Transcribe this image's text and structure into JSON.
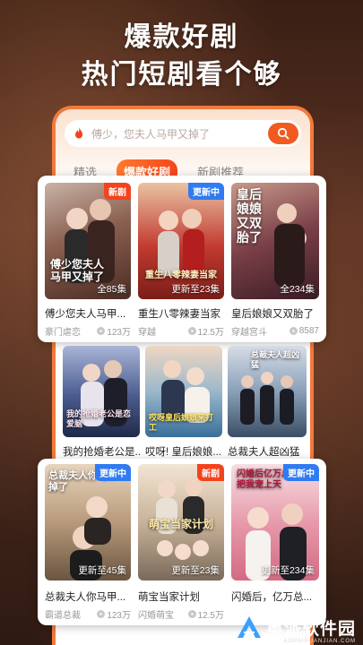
{
  "headline": {
    "line1": "爆款好剧",
    "line2": "热门短剧看个够"
  },
  "search": {
    "placeholder": "傅少，您夫人马甲又掉了"
  },
  "tabs": [
    {
      "label": "精选",
      "active": false
    },
    {
      "label": "爆款好剧",
      "active": true
    },
    {
      "label": "新剧推荐",
      "active": false
    }
  ],
  "rows": [
    {
      "items": [
        {
          "title": "傅少您夫人马甲...",
          "tag": "豪门虐恋",
          "views": "123万",
          "badge": "新剧",
          "badge_type": "new",
          "episodes": "全85集",
          "poster_text": "傅少您夫人马甲又掉了",
          "colors": [
            "#6b4a3a",
            "#c9b3a6"
          ]
        },
        {
          "title": "重生八零辣妻当家",
          "tag": "穿越",
          "views": "12.5万",
          "badge": "更新中",
          "badge_type": "update",
          "episodes": "更新至23集",
          "poster_text": "重生八零辣妻当家",
          "colors": [
            "#b8322a",
            "#e9c3a3"
          ]
        },
        {
          "title": "皇后娘娘又双胎了",
          "tag": "穿越宫斗",
          "views": "8587",
          "badge": "",
          "badge_type": "",
          "episodes": "全234集",
          "poster_text": "皇后娘娘又双胎了",
          "colors": [
            "#5a2f3a",
            "#c89a8a"
          ]
        }
      ]
    },
    {
      "items": [
        {
          "title": "我的抢婚老公是...",
          "tag": "",
          "views": "",
          "badge": "",
          "badge_type": "",
          "episodes": "",
          "poster_text": "我的抢婚老公是恋爱脑",
          "colors": [
            "#2e3f6a",
            "#a9b4d6"
          ]
        },
        {
          "title": "哎呀! 皇后娘娘...",
          "tag": "",
          "views": "",
          "badge": "",
          "badge_type": "",
          "episodes": "",
          "poster_text": "哎呀皇后娘娘来打工",
          "colors": [
            "#3a6f9a",
            "#f0d7c2"
          ]
        },
        {
          "title": "总裁夫人超凶猛",
          "tag": "",
          "views": "",
          "badge": "",
          "badge_type": "",
          "episodes": "",
          "poster_text": "总裁夫人超凶猛",
          "colors": [
            "#4f6f8f",
            "#d6dde6"
          ]
        }
      ]
    },
    {
      "items": [
        {
          "title": "总裁夫人你马甲...",
          "tag": "霸道总裁",
          "views": "123万",
          "badge": "更新中",
          "badge_type": "update",
          "episodes": "更新至45集",
          "poster_text": "总裁夫人你马甲掉了",
          "colors": [
            "#6a5540",
            "#e8d4bd"
          ]
        },
        {
          "title": "萌宝当家计划",
          "tag": "闪婚萌宝",
          "views": "12.5万",
          "badge": "新剧",
          "badge_type": "new",
          "episodes": "更新至23集",
          "poster_text": "萌宝当家计划",
          "colors": [
            "#7a6a5a",
            "#f3e5d3"
          ]
        },
        {
          "title": "闪婚后，亿万总...",
          "tag": "",
          "views": "",
          "badge": "更新中",
          "badge_type": "update",
          "episodes": "更新至234集",
          "poster_text": "闪婚后亿万总裁把我宠上天",
          "colors": [
            "#d46a82",
            "#f6dfe4"
          ]
        }
      ]
    }
  ],
  "watermark": {
    "brand": "奥派软件园",
    "sub": "AOPAIRUANJIAN.COM"
  },
  "colors": {
    "accent": "#f25a1f",
    "update_badge": "#2f7bf2",
    "new_badge": "#f2431c"
  }
}
